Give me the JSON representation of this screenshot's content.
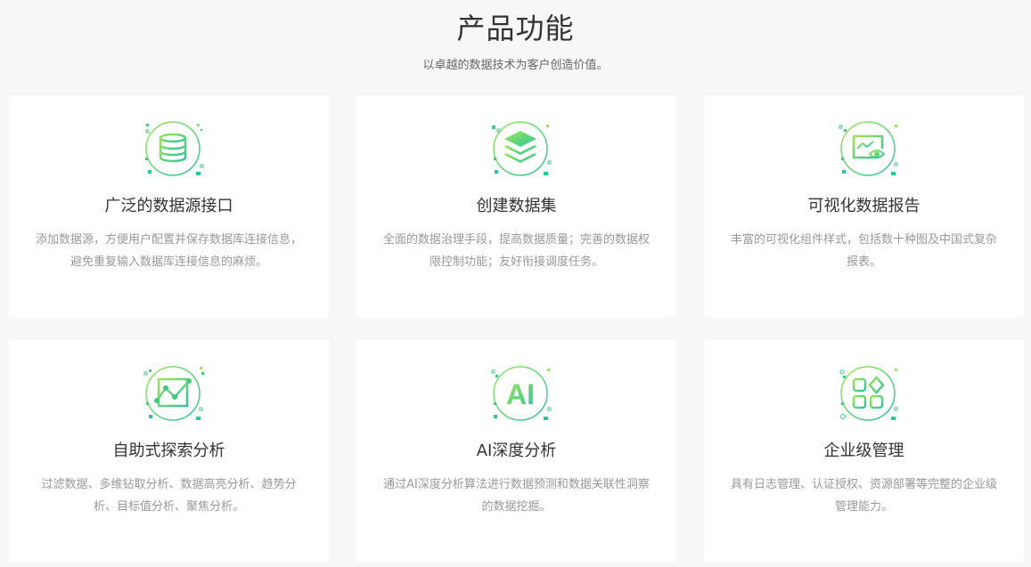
{
  "header": {
    "title": "产品功能",
    "subtitle": "以卓越的数据技术为客户创造价值。"
  },
  "cards": [
    {
      "icon": "database-icon",
      "title": "广泛的数据源接口",
      "description": "添加数据源，方便用户配置并保存数据库连接信息，避免重复输入数据库连接信息的麻烦。"
    },
    {
      "icon": "layers-icon",
      "title": "创建数据集",
      "description": "全面的数据治理手段，提高数据质量；完善的数据权限控制功能；友好衔接调度任务。"
    },
    {
      "icon": "chart-eye-icon",
      "title": "可视化数据报告",
      "description": "丰富的可视化组件样式，包括数十种图及中国式复杂报表。"
    },
    {
      "icon": "line-chart-icon",
      "title": "自助式探索分析",
      "description": "过滤数据、多维钻取分析、数据高亮分析、趋势分析、目标值分析、聚焦分析。"
    },
    {
      "icon": "ai-icon",
      "title": "AI深度分析",
      "description": "通过AI深度分析算法进行数据预测和数据关联性洞察的数据挖掘。",
      "icon_text": "AI"
    },
    {
      "icon": "apps-grid-icon",
      "title": "企业级管理",
      "description": "具有日志管理、认证授权、资源部署等完整的企业级管理能力。"
    }
  ],
  "colors": {
    "accent_green": "#45c97f",
    "accent_light": "#9ce65a",
    "background": "#f7f7f7",
    "card": "#ffffff",
    "title_text": "#333333",
    "desc_text": "#999999"
  }
}
